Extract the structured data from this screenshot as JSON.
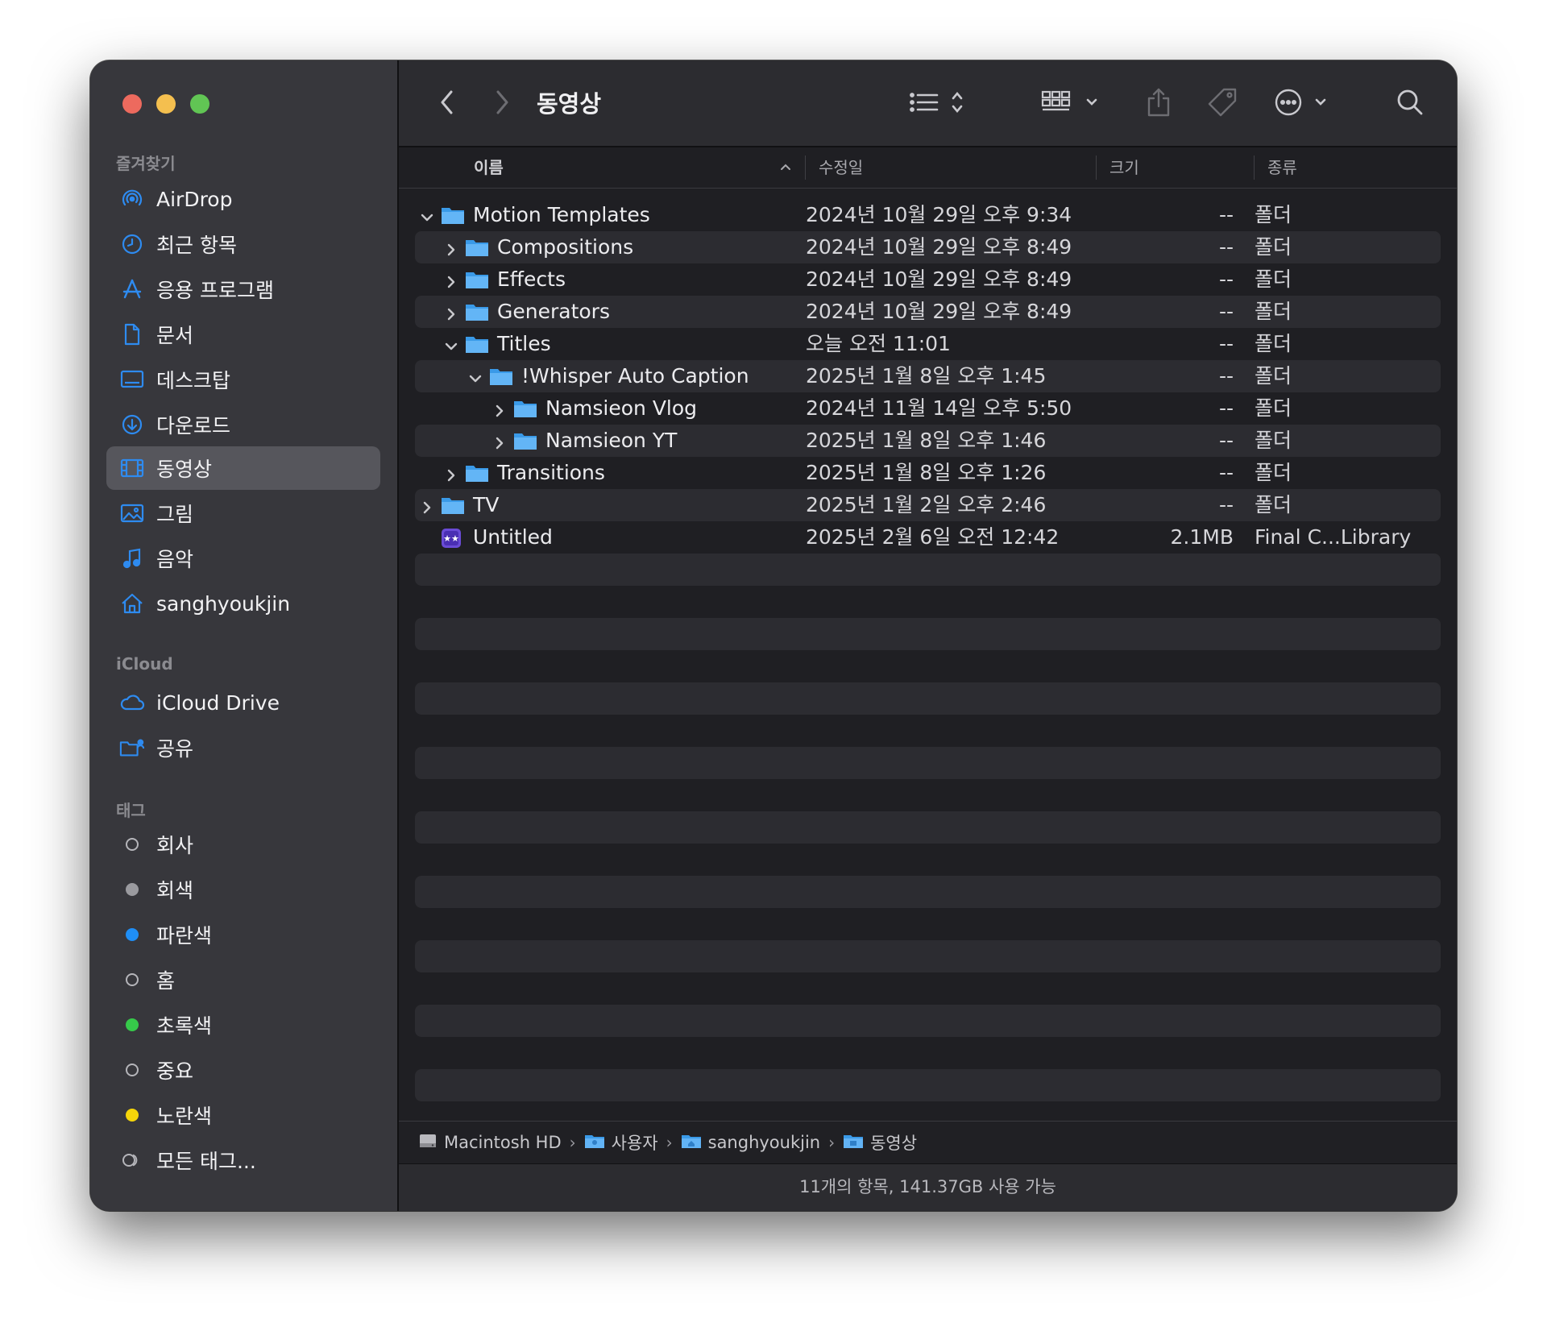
{
  "window": {
    "title": "동영상"
  },
  "sidebar": {
    "favorites_header": "즐겨찾기",
    "favorites": [
      {
        "label": "AirDrop",
        "icon": "airdrop-icon"
      },
      {
        "label": "최근 항목",
        "icon": "clock-icon"
      },
      {
        "label": "응용 프로그램",
        "icon": "applications-icon"
      },
      {
        "label": "문서",
        "icon": "document-icon"
      },
      {
        "label": "데스크탑",
        "icon": "desktop-icon"
      },
      {
        "label": "다운로드",
        "icon": "download-icon"
      },
      {
        "label": "동영상",
        "icon": "movies-icon",
        "selected": true
      },
      {
        "label": "그림",
        "icon": "pictures-icon"
      },
      {
        "label": "음악",
        "icon": "music-icon"
      },
      {
        "label": "sanghyoukjin",
        "icon": "home-icon"
      }
    ],
    "icloud_header": "iCloud",
    "icloud": [
      {
        "label": "iCloud Drive",
        "icon": "cloud-icon"
      },
      {
        "label": "공유",
        "icon": "shared-folder-icon"
      }
    ],
    "tags_header": "태그",
    "tags": [
      {
        "label": "회사",
        "color": "outline"
      },
      {
        "label": "회색",
        "color": "#9a9a9f"
      },
      {
        "label": "파란색",
        "color": "#1f8ef5"
      },
      {
        "label": "홈",
        "color": "outline"
      },
      {
        "label": "초록색",
        "color": "#36c94a"
      },
      {
        "label": "중요",
        "color": "outline"
      },
      {
        "label": "노란색",
        "color": "#f5d50a"
      },
      {
        "label": "모든 태그...",
        "color": "all"
      }
    ]
  },
  "columns": {
    "name": "이름",
    "modified": "수정일",
    "size": "크기",
    "kind": "종류"
  },
  "files": [
    {
      "name": "Motion Templates",
      "date": "2024년 10월 29일 오후 9:34",
      "size": "--",
      "kind": "폴더",
      "depth": 0,
      "expanded": true,
      "type": "folder"
    },
    {
      "name": "Compositions",
      "date": "2024년 10월 29일 오후 8:49",
      "size": "--",
      "kind": "폴더",
      "depth": 1,
      "expanded": false,
      "type": "folder"
    },
    {
      "name": "Effects",
      "date": "2024년 10월 29일 오후 8:49",
      "size": "--",
      "kind": "폴더",
      "depth": 1,
      "expanded": false,
      "type": "folder"
    },
    {
      "name": "Generators",
      "date": "2024년 10월 29일 오후 8:49",
      "size": "--",
      "kind": "폴더",
      "depth": 1,
      "expanded": false,
      "type": "folder"
    },
    {
      "name": "Titles",
      "date": "오늘 오전 11:01",
      "size": "--",
      "kind": "폴더",
      "depth": 1,
      "expanded": true,
      "type": "folder"
    },
    {
      "name": "!Whisper Auto Caption",
      "date": "2025년 1월 8일 오후 1:45",
      "size": "--",
      "kind": "폴더",
      "depth": 2,
      "expanded": true,
      "type": "folder"
    },
    {
      "name": "Namsieon Vlog",
      "date": "2024년 11월 14일 오후 5:50",
      "size": "--",
      "kind": "폴더",
      "depth": 3,
      "expanded": false,
      "type": "folder"
    },
    {
      "name": "Namsieon YT",
      "date": "2025년 1월 8일 오후 1:46",
      "size": "--",
      "kind": "폴더",
      "depth": 3,
      "expanded": false,
      "type": "folder"
    },
    {
      "name": "Transitions",
      "date": "2025년 1월 8일 오후 1:26",
      "size": "--",
      "kind": "폴더",
      "depth": 1,
      "expanded": false,
      "type": "folder"
    },
    {
      "name": "TV",
      "date": "2025년 1월 2일 오후 2:46",
      "size": "--",
      "kind": "폴더",
      "depth": 0,
      "expanded": false,
      "type": "folder"
    },
    {
      "name": "Untitled",
      "date": "2025년 2월 6일 오전 12:42",
      "size": "2.1MB",
      "kind": "Final C...Library",
      "depth": 0,
      "expanded": null,
      "type": "library"
    }
  ],
  "pathbar": [
    {
      "label": "Macintosh HD",
      "icon": "hard-drive-icon"
    },
    {
      "label": "사용자",
      "icon": "users-folder-icon"
    },
    {
      "label": "sanghyoukjin",
      "icon": "home-folder-icon"
    },
    {
      "label": "동영상",
      "icon": "movies-folder-icon"
    }
  ],
  "status": "11개의 항목, 141.37GB 사용 가능"
}
